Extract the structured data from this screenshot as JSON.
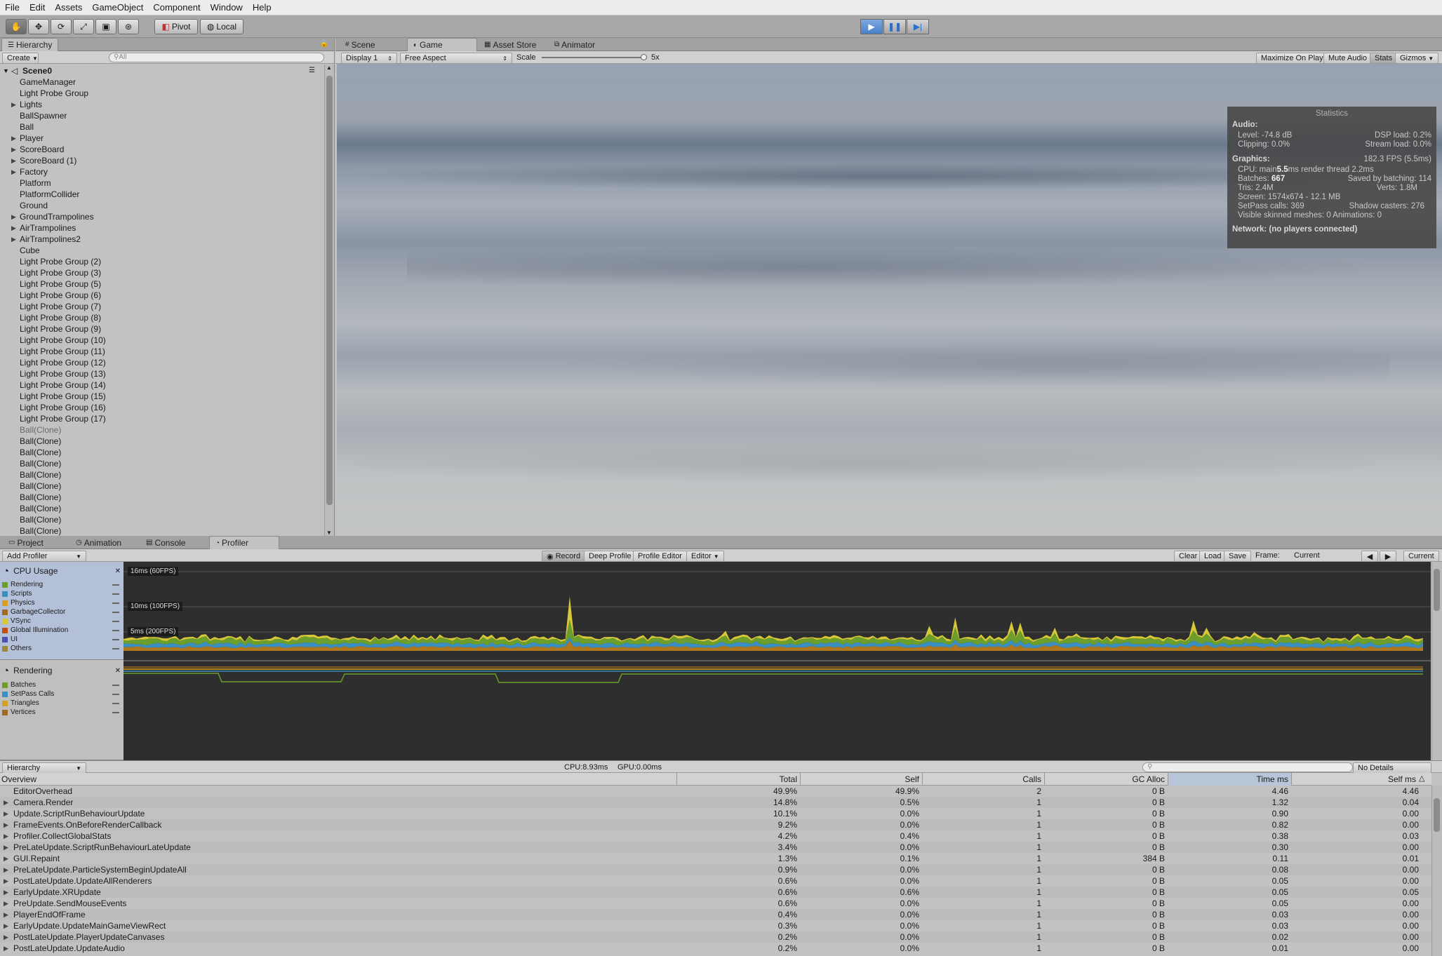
{
  "menu": [
    "File",
    "Edit",
    "Assets",
    "GameObject",
    "Component",
    "Window",
    "Help"
  ],
  "toolbar": {
    "pivot": "Pivot",
    "local": "Local"
  },
  "hierarchy": {
    "tab": "Hierarchy",
    "create": "Create",
    "search_placeholder": "All",
    "scene": "Scene0",
    "items": [
      {
        "label": "GameManager",
        "arrow": ""
      },
      {
        "label": "Light Probe Group",
        "arrow": ""
      },
      {
        "label": "Lights",
        "arrow": "▶"
      },
      {
        "label": "BallSpawner",
        "arrow": ""
      },
      {
        "label": "Ball",
        "arrow": ""
      },
      {
        "label": "Player",
        "arrow": "▶"
      },
      {
        "label": "ScoreBoard",
        "arrow": "▶"
      },
      {
        "label": "ScoreBoard (1)",
        "arrow": "▶"
      },
      {
        "label": "Factory",
        "arrow": "▶"
      },
      {
        "label": "Platform",
        "arrow": ""
      },
      {
        "label": "PlatformCollider",
        "arrow": ""
      },
      {
        "label": "Ground",
        "arrow": ""
      },
      {
        "label": "GroundTrampolines",
        "arrow": "▶"
      },
      {
        "label": "AirTrampolines",
        "arrow": "▶"
      },
      {
        "label": "AirTrampolines2",
        "arrow": "▶"
      },
      {
        "label": "Cube",
        "arrow": ""
      },
      {
        "label": "Light Probe Group (2)",
        "arrow": ""
      },
      {
        "label": "Light Probe Group (3)",
        "arrow": ""
      },
      {
        "label": "Light Probe Group (5)",
        "arrow": ""
      },
      {
        "label": "Light Probe Group (6)",
        "arrow": ""
      },
      {
        "label": "Light Probe Group (7)",
        "arrow": ""
      },
      {
        "label": "Light Probe Group (8)",
        "arrow": ""
      },
      {
        "label": "Light Probe Group (9)",
        "arrow": ""
      },
      {
        "label": "Light Probe Group (10)",
        "arrow": ""
      },
      {
        "label": "Light Probe Group (11)",
        "arrow": ""
      },
      {
        "label": "Light Probe Group (12)",
        "arrow": ""
      },
      {
        "label": "Light Probe Group (13)",
        "arrow": ""
      },
      {
        "label": "Light Probe Group (14)",
        "arrow": ""
      },
      {
        "label": "Light Probe Group (15)",
        "arrow": ""
      },
      {
        "label": "Light Probe Group (16)",
        "arrow": ""
      },
      {
        "label": "Light Probe Group (17)",
        "arrow": ""
      },
      {
        "label": "Ball(Clone)",
        "arrow": "",
        "dim": true
      },
      {
        "label": "Ball(Clone)",
        "arrow": ""
      },
      {
        "label": "Ball(Clone)",
        "arrow": ""
      },
      {
        "label": "Ball(Clone)",
        "arrow": ""
      },
      {
        "label": "Ball(Clone)",
        "arrow": ""
      },
      {
        "label": "Ball(Clone)",
        "arrow": ""
      },
      {
        "label": "Ball(Clone)",
        "arrow": ""
      },
      {
        "label": "Ball(Clone)",
        "arrow": ""
      },
      {
        "label": "Ball(Clone)",
        "arrow": ""
      },
      {
        "label": "Ball(Clone)",
        "arrow": ""
      }
    ]
  },
  "view_tabs": [
    "Scene",
    "Game",
    "Asset Store",
    "Animator"
  ],
  "game_bar": {
    "display": "Display 1",
    "aspect": "Free Aspect",
    "scale_label": "Scale",
    "scale_value": "5x",
    "maximize": "Maximize On Play",
    "mute": "Mute Audio",
    "stats": "Stats",
    "gizmos": "Gizmos"
  },
  "statistics": {
    "title": "Statistics",
    "audio_hd": "Audio:",
    "level": "Level: -74.8 dB",
    "dsp": "DSP load: 0.2%",
    "clipping": "Clipping: 0.0%",
    "stream": "Stream load: 0.0%",
    "graphics_hd": "Graphics:",
    "fps": "182.3 FPS (5.5ms)",
    "cpu_a": "CPU: main ",
    "cpu_b": "5.5",
    "cpu_c": "ms  render thread 2.2ms",
    "batches_a": "Batches: ",
    "batches_b": "667",
    "saved": "Saved by batching: 114",
    "tris": "Tris: 2.4M",
    "verts": "Verts: 1.8M",
    "screen": "Screen: 1574x674 - 12.1 MB",
    "setpass": "SetPass calls: 369",
    "shadow": "Shadow casters: 276",
    "skinned": "Visible skinned meshes: 0  Animations: 0",
    "network": "Network: (no players connected)"
  },
  "bottom_tabs": [
    "Project",
    "Animation",
    "Console",
    "Profiler"
  ],
  "profiler_bar": {
    "add": "Add Profiler",
    "record": "Record",
    "deep": "Deep Profile",
    "pedit": "Profile Editor",
    "editor": "Editor",
    "clear": "Clear",
    "load": "Load",
    "save": "Save",
    "frame": "Frame:",
    "frame_val": "Current",
    "current": "Current"
  },
  "cpu_module": {
    "title": "CPU Usage",
    "legend": [
      {
        "label": "Rendering",
        "color": "#6c9e2c"
      },
      {
        "label": "Scripts",
        "color": "#3a8ec0"
      },
      {
        "label": "Physics",
        "color": "#d8a020"
      },
      {
        "label": "GarbageCollector",
        "color": "#a06a20"
      },
      {
        "label": "VSync",
        "color": "#d8c838"
      },
      {
        "label": "Global Illumination",
        "color": "#c05010"
      },
      {
        "label": "UI",
        "color": "#5050b0"
      },
      {
        "label": "Others",
        "color": "#9a8a3a"
      }
    ],
    "line_16": "16ms (60FPS)",
    "line_10": "10ms (100FPS)",
    "line_5": "5ms (200FPS)"
  },
  "render_module": {
    "title": "Rendering",
    "legend": [
      {
        "label": "Batches",
        "color": "#6c9e2c"
      },
      {
        "label": "SetPass Calls",
        "color": "#3a8ec0"
      },
      {
        "label": "Triangles",
        "color": "#d8a020"
      },
      {
        "label": "Vertices",
        "color": "#a06a20"
      }
    ]
  },
  "details_bar": {
    "mode": "Hierarchy",
    "cpu": "CPU:8.93ms",
    "gpu": "GPU:0.00ms",
    "details": "No Details"
  },
  "table": {
    "headers": [
      "Overview",
      "Total",
      "Self",
      "Calls",
      "GC Alloc",
      "Time ms",
      "Self ms"
    ],
    "rows": [
      {
        "name": "EditorOverhead",
        "arrow": "",
        "total": "49.9%",
        "self": "49.9%",
        "calls": "2",
        "gc": "0 B",
        "time": "4.46",
        "selfms": "4.46"
      },
      {
        "name": "Camera.Render",
        "arrow": "▶",
        "total": "14.8%",
        "self": "0.5%",
        "calls": "1",
        "gc": "0 B",
        "time": "1.32",
        "selfms": "0.04"
      },
      {
        "name": "Update.ScriptRunBehaviourUpdate",
        "arrow": "▶",
        "total": "10.1%",
        "self": "0.0%",
        "calls": "1",
        "gc": "0 B",
        "time": "0.90",
        "selfms": "0.00"
      },
      {
        "name": "FrameEvents.OnBeforeRenderCallback",
        "arrow": "▶",
        "total": "9.2%",
        "self": "0.0%",
        "calls": "1",
        "gc": "0 B",
        "time": "0.82",
        "selfms": "0.00"
      },
      {
        "name": "Profiler.CollectGlobalStats",
        "arrow": "▶",
        "total": "4.2%",
        "self": "0.4%",
        "calls": "1",
        "gc": "0 B",
        "time": "0.38",
        "selfms": "0.03"
      },
      {
        "name": "PreLateUpdate.ScriptRunBehaviourLateUpdate",
        "arrow": "▶",
        "total": "3.4%",
        "self": "0.0%",
        "calls": "1",
        "gc": "0 B",
        "time": "0.30",
        "selfms": "0.00"
      },
      {
        "name": "GUI.Repaint",
        "arrow": "▶",
        "total": "1.3%",
        "self": "0.1%",
        "calls": "1",
        "gc": "384 B",
        "time": "0.11",
        "selfms": "0.01"
      },
      {
        "name": "PreLateUpdate.ParticleSystemBeginUpdateAll",
        "arrow": "▶",
        "total": "0.9%",
        "self": "0.0%",
        "calls": "1",
        "gc": "0 B",
        "time": "0.08",
        "selfms": "0.00"
      },
      {
        "name": "PostLateUpdate.UpdateAllRenderers",
        "arrow": "▶",
        "total": "0.6%",
        "self": "0.0%",
        "calls": "1",
        "gc": "0 B",
        "time": "0.05",
        "selfms": "0.00"
      },
      {
        "name": "EarlyUpdate.XRUpdate",
        "arrow": "▶",
        "total": "0.6%",
        "self": "0.6%",
        "calls": "1",
        "gc": "0 B",
        "time": "0.05",
        "selfms": "0.05"
      },
      {
        "name": "PreUpdate.SendMouseEvents",
        "arrow": "▶",
        "total": "0.6%",
        "self": "0.0%",
        "calls": "1",
        "gc": "0 B",
        "time": "0.05",
        "selfms": "0.00"
      },
      {
        "name": "PlayerEndOfFrame",
        "arrow": "▶",
        "total": "0.4%",
        "self": "0.0%",
        "calls": "1",
        "gc": "0 B",
        "time": "0.03",
        "selfms": "0.00"
      },
      {
        "name": "EarlyUpdate.UpdateMainGameViewRect",
        "arrow": "▶",
        "total": "0.3%",
        "self": "0.0%",
        "calls": "1",
        "gc": "0 B",
        "time": "0.03",
        "selfms": "0.00"
      },
      {
        "name": "PostLateUpdate.PlayerUpdateCanvases",
        "arrow": "▶",
        "total": "0.2%",
        "self": "0.0%",
        "calls": "1",
        "gc": "0 B",
        "time": "0.02",
        "selfms": "0.00"
      },
      {
        "name": "PostLateUpdate.UpdateAudio",
        "arrow": "▶",
        "total": "0.2%",
        "self": "0.0%",
        "calls": "1",
        "gc": "0 B",
        "time": "0.01",
        "selfms": "0.00"
      }
    ]
  }
}
